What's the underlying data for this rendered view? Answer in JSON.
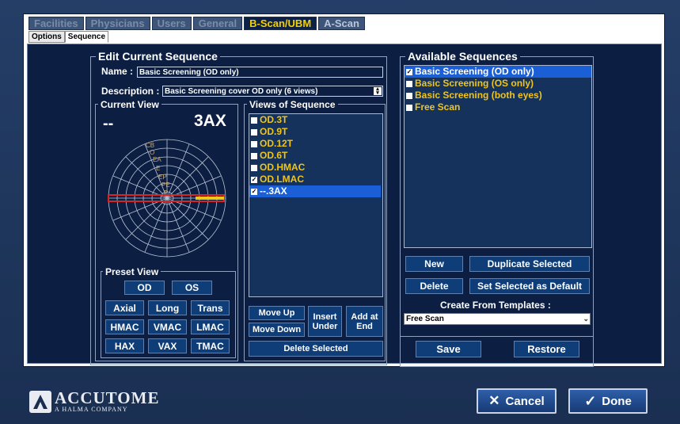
{
  "tabs": [
    {
      "label": "Facilities",
      "active": false
    },
    {
      "label": "Physicians",
      "active": false
    },
    {
      "label": "Users",
      "active": false
    },
    {
      "label": "General",
      "active": false
    },
    {
      "label": "B-Scan/UBM",
      "active": true
    },
    {
      "label": "A-Scan",
      "active": false
    }
  ],
  "subtabs": [
    {
      "label": "Options",
      "active": false
    },
    {
      "label": "Sequence",
      "active": true
    }
  ],
  "edit": {
    "legend": "Edit Current Sequence",
    "name_label": "Name :",
    "name_value": "Basic Screening (OD only)",
    "desc_label": "Description :",
    "desc_value": "Basic Screening cover OD only (6 views)"
  },
  "current_view": {
    "legend": "Current View",
    "left_text": "--",
    "right_text": "3AX",
    "ring_labels": [
      "CB",
      "O",
      "EA",
      "E",
      "EP",
      "PE",
      "P"
    ]
  },
  "views": {
    "legend": "Views of Sequence",
    "items": [
      {
        "label": "OD.3T",
        "checked": false,
        "selected": false
      },
      {
        "label": "OD.9T",
        "checked": false,
        "selected": false
      },
      {
        "label": "OD.12T",
        "checked": false,
        "selected": false
      },
      {
        "label": "OD.6T",
        "checked": false,
        "selected": false
      },
      {
        "label": "OD.HMAC",
        "checked": false,
        "selected": false
      },
      {
        "label": "OD.LMAC",
        "checked": true,
        "selected": false
      },
      {
        "label": "--.3AX",
        "checked": true,
        "selected": true
      }
    ],
    "move_up": "Move Up",
    "move_down": "Move Down",
    "insert_under": "Insert Under",
    "add_at_end": "Add at End",
    "delete_selected": "Delete Selected"
  },
  "preset": {
    "legend": "Preset View",
    "od": "OD",
    "os": "OS",
    "axial": "Axial",
    "long": "Long",
    "trans": "Trans",
    "hmac": "HMAC",
    "vmac": "VMAC",
    "lmac": "LMAC",
    "hax": "HAX",
    "vax": "VAX",
    "tmac": "TMAC"
  },
  "available": {
    "legend": "Available Sequences",
    "items": [
      {
        "label": "Basic Screening (OD only)",
        "checked": true,
        "selected": true
      },
      {
        "label": "Basic Screening (OS only)",
        "checked": false,
        "selected": false
      },
      {
        "label": "Basic Screening (both eyes)",
        "checked": false,
        "selected": false
      },
      {
        "label": "Free Scan",
        "checked": false,
        "selected": false
      }
    ],
    "new": "New",
    "duplicate": "Duplicate Selected",
    "delete": "Delete",
    "set_default": "Set Selected as Default",
    "templates_label": "Create From Templates :",
    "template_value": "Free Scan"
  },
  "save": "Save",
  "restore": "Restore",
  "cancel": "Cancel",
  "done": "Done",
  "logo": {
    "brand": "ACCUTOME",
    "tagline": "A HALMA COMPANY"
  },
  "colors": {
    "accent": "#f0c419",
    "selection": "#1b5fd6",
    "panel": "#0c1f42"
  }
}
